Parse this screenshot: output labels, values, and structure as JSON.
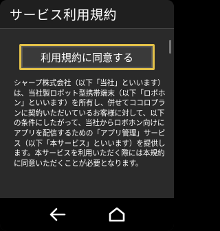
{
  "header": {
    "title": "サービス利用規約"
  },
  "main": {
    "agree_button_label": "利用規約に同意する",
    "terms_text": "シャープ株式会社（以下「当社」といいます）は、当社製ロボット型携帯端末（以下「ロボホン」といいます）を所有し、併せてココロプランに契約いただいているお客様に対して、以下の条件にしたがって、当社からロボホン向けにアプリを配信するための「アプリ管理」サービス（以下「本サービス」といいます）を提供します。本サービスを利用いただく際には本規約に同意いただくことが必要となります。"
  },
  "nav": {
    "back_icon": "back-arrow-icon",
    "home_icon": "home-icon"
  },
  "colors": {
    "accent": "#e2c048",
    "header_bg": "#1f1f1f",
    "content_bg": "#2a2a2a"
  }
}
